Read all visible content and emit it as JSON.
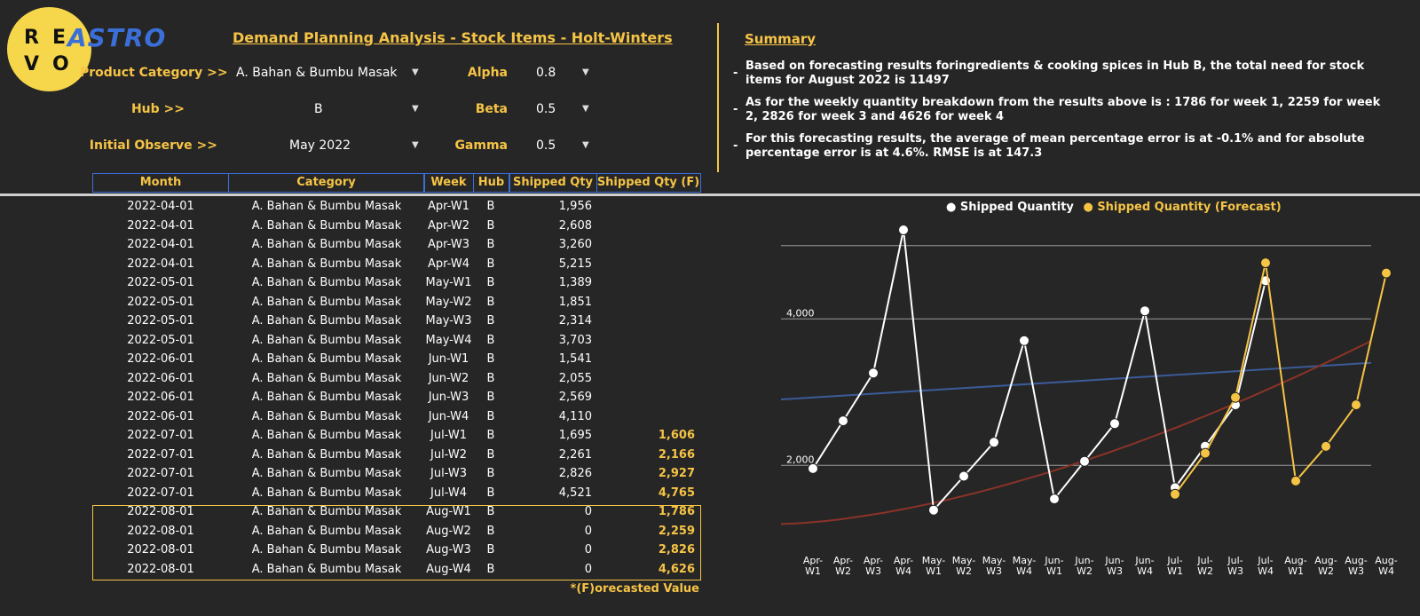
{
  "logo": {
    "letters": [
      "R",
      "E",
      "V",
      "O"
    ],
    "brand": "ASTRO"
  },
  "title": "Demand Planning Analysis - Stock Items - Holt-Winters",
  "filters": {
    "product_category": {
      "label": "Product Category >>",
      "value": "A. Bahan & Bumbu Masak"
    },
    "hub": {
      "label": "Hub >>",
      "value": "B"
    },
    "initial_observe": {
      "label": "Initial Observe >>",
      "value": "May 2022"
    },
    "alpha": {
      "label": "Alpha",
      "value": "0.8"
    },
    "beta": {
      "label": "Beta",
      "value": "0.5"
    },
    "gamma": {
      "label": "Gamma",
      "value": "0.5"
    }
  },
  "summary": {
    "title": "Summary",
    "items": [
      "Based on forecasting results foringredients & cooking spices in Hub B, the total need for stock items for August 2022 is 11497",
      "As for the weekly quantity breakdown from the results above is : 1786 for week 1, 2259 for week 2, 2826 for week 3 and 4626 for week 4",
      "For this forecasting results, the average of mean percentage error is at -0.1% and for absolute percentage error is at 4.6%. RMSE is at 147.3"
    ]
  },
  "table": {
    "headers": [
      "Month",
      "Category",
      "Week",
      "Hub",
      "Shipped Qty",
      "Shipped Qty (F)"
    ],
    "rows": [
      [
        "2022-04-01",
        "A. Bahan & Bumbu Masak",
        "Apr-W1",
        "B",
        "1,956",
        ""
      ],
      [
        "2022-04-01",
        "A. Bahan & Bumbu Masak",
        "Apr-W2",
        "B",
        "2,608",
        ""
      ],
      [
        "2022-04-01",
        "A. Bahan & Bumbu Masak",
        "Apr-W3",
        "B",
        "3,260",
        ""
      ],
      [
        "2022-04-01",
        "A. Bahan & Bumbu Masak",
        "Apr-W4",
        "B",
        "5,215",
        ""
      ],
      [
        "2022-05-01",
        "A. Bahan & Bumbu Masak",
        "May-W1",
        "B",
        "1,389",
        ""
      ],
      [
        "2022-05-01",
        "A. Bahan & Bumbu Masak",
        "May-W2",
        "B",
        "1,851",
        ""
      ],
      [
        "2022-05-01",
        "A. Bahan & Bumbu Masak",
        "May-W3",
        "B",
        "2,314",
        ""
      ],
      [
        "2022-05-01",
        "A. Bahan & Bumbu Masak",
        "May-W4",
        "B",
        "3,703",
        ""
      ],
      [
        "2022-06-01",
        "A. Bahan & Bumbu Masak",
        "Jun-W1",
        "B",
        "1,541",
        ""
      ],
      [
        "2022-06-01",
        "A. Bahan & Bumbu Masak",
        "Jun-W2",
        "B",
        "2,055",
        ""
      ],
      [
        "2022-06-01",
        "A. Bahan & Bumbu Masak",
        "Jun-W3",
        "B",
        "2,569",
        ""
      ],
      [
        "2022-06-01",
        "A. Bahan & Bumbu Masak",
        "Jun-W4",
        "B",
        "4,110",
        ""
      ],
      [
        "2022-07-01",
        "A. Bahan & Bumbu Masak",
        "Jul-W1",
        "B",
        "1,695",
        "1,606"
      ],
      [
        "2022-07-01",
        "A. Bahan & Bumbu Masak",
        "Jul-W2",
        "B",
        "2,261",
        "2,166"
      ],
      [
        "2022-07-01",
        "A. Bahan & Bumbu Masak",
        "Jul-W3",
        "B",
        "2,826",
        "2,927"
      ],
      [
        "2022-07-01",
        "A. Bahan & Bumbu Masak",
        "Jul-W4",
        "B",
        "4,521",
        "4,765"
      ],
      [
        "2022-08-01",
        "A. Bahan & Bumbu Masak",
        "Aug-W1",
        "B",
        "0",
        "1,786"
      ],
      [
        "2022-08-01",
        "A. Bahan & Bumbu Masak",
        "Aug-W2",
        "B",
        "0",
        "2,259"
      ],
      [
        "2022-08-01",
        "A. Bahan & Bumbu Masak",
        "Aug-W3",
        "B",
        "0",
        "2,826"
      ],
      [
        "2022-08-01",
        "A. Bahan & Bumbu Masak",
        "Aug-W4",
        "B",
        "0",
        "4,626"
      ]
    ],
    "footnote": "*(F)orecasted Value"
  },
  "chart_data": {
    "type": "line",
    "categories": [
      "Apr-W1",
      "Apr-W2",
      "Apr-W3",
      "Apr-W4",
      "May-W1",
      "May-W2",
      "May-W3",
      "May-W4",
      "Jun-W1",
      "Jun-W2",
      "Jun-W3",
      "Jun-W4",
      "Jul-W1",
      "Jul-W2",
      "Jul-W3",
      "Jul-W4",
      "Aug-W1",
      "Aug-W2",
      "Aug-W3",
      "Aug-W4"
    ],
    "series": [
      {
        "name": "Shipped Quantity",
        "color": "#ffffff",
        "values": [
          1956,
          2608,
          3260,
          5215,
          1389,
          1851,
          2314,
          3703,
          1541,
          2055,
          2569,
          4110,
          1695,
          2261,
          2826,
          4521,
          null,
          null,
          null,
          null
        ]
      },
      {
        "name": "Shipped Quantity (Forecast)",
        "color": "#f6c445",
        "values": [
          null,
          null,
          null,
          null,
          null,
          null,
          null,
          null,
          null,
          null,
          null,
          null,
          1606,
          2166,
          2927,
          4765,
          1786,
          2259,
          2826,
          4626
        ]
      }
    ],
    "trendlines": [
      {
        "color": "#3b5b99",
        "values": [
          2900,
          3400
        ]
      },
      {
        "color": "#8b3328",
        "values": [
          1200,
          3700
        ]
      }
    ],
    "y_ticks": [
      "4,000",
      "2,000"
    ],
    "ylim": [
      900,
      5300
    ],
    "grid": true,
    "legend_position": "top"
  }
}
